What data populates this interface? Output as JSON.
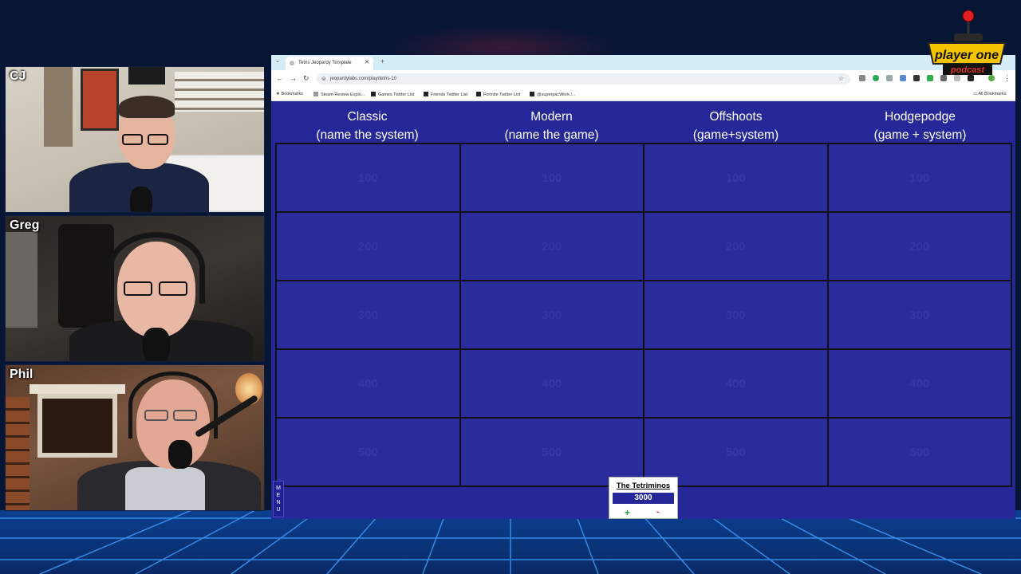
{
  "stream": {
    "logo_text_top": "player one",
    "logo_text_bottom": "podcast"
  },
  "cams": [
    {
      "name": "CJ"
    },
    {
      "name": "Greg"
    },
    {
      "name": "Phil"
    }
  ],
  "browser": {
    "tab_title": "Tetris Jeopardy Template",
    "url": "jeopardylabs.com/play/tetris-10",
    "bookmarks": [
      "Bookmarks",
      "Steam Review Explo...",
      "Games Twitter List",
      "Friends Twitter List",
      "Fortnite Twitter List",
      "@superpacWork /..."
    ],
    "all_bookmarks": "All Bookmarks"
  },
  "board": {
    "categories": [
      {
        "line1": "Classic",
        "line2": "(name the system)"
      },
      {
        "line1": "Modern",
        "line2": "(name the game)"
      },
      {
        "line1": "Offshoots",
        "line2": "(game+system)"
      },
      {
        "line1": "Hodgepodge",
        "line2": "(game + system)"
      }
    ],
    "values": [
      "100",
      "200",
      "300",
      "400",
      "500"
    ],
    "menu_label": [
      "M",
      "E",
      "N",
      "U"
    ],
    "team": {
      "name": "The Tetriminos",
      "score": "3000",
      "plus": "+",
      "minus": "-"
    }
  },
  "colors": {
    "board_blue": "#26289a",
    "background": "#061634",
    "grid_line": "#111111"
  }
}
